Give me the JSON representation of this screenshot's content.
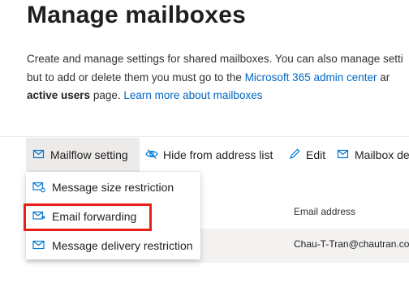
{
  "page": {
    "title": "Manage mailboxes",
    "desc_line1": "Create and manage settings for shared mailboxes. You can also manage setti",
    "desc_line2_before": "but to add or delete them you must go to the ",
    "desc_link_admin": "Microsoft 365 admin center",
    "desc_line2_after": " ar",
    "desc_bold": "active users",
    "desc_line3_mid": " page. ",
    "desc_link_learn": "Learn more about mailboxes"
  },
  "toolbar": {
    "mailflow_label": "Mailflow setting",
    "hide_label": "Hide from address list",
    "edit_label": "Edit",
    "mailbox_label": "Mailbox de"
  },
  "dropdown": {
    "items": [
      {
        "label": "Message size restriction",
        "icon": "mail-settings-icon"
      },
      {
        "label": "Email forwarding",
        "icon": "mail-forward-icon"
      },
      {
        "label": "Message delivery restriction",
        "icon": "mail-icon"
      }
    ]
  },
  "table": {
    "col_email": "Email address",
    "rows": [
      {
        "email": "Chau-T-Tran@chautran.cor"
      }
    ]
  },
  "colors": {
    "link": "#0066c4",
    "icon": "#0078d4",
    "highlight": "#e8201b",
    "selected_bg": "#edebe9",
    "row_bg": "#f3f2f1"
  }
}
